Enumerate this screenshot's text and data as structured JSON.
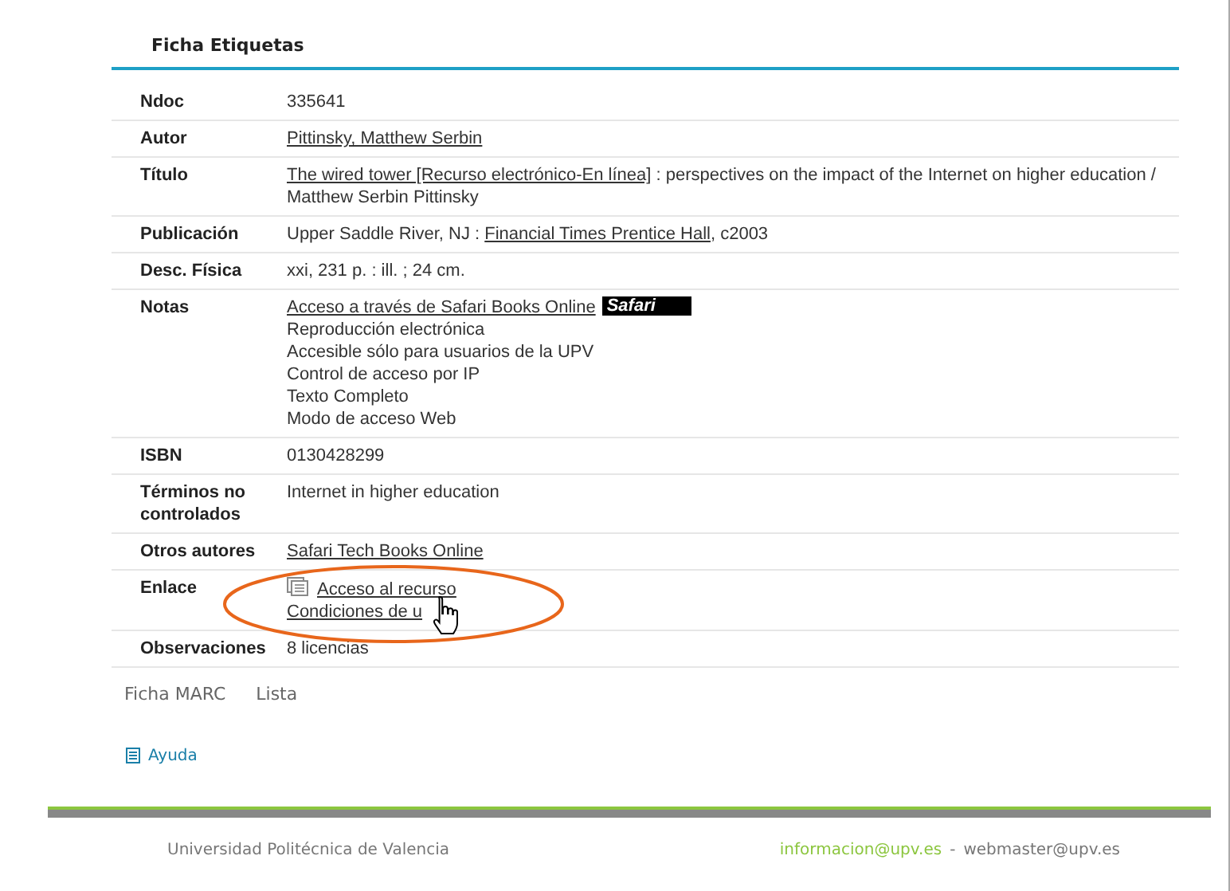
{
  "title": "Ficha Etiquetas",
  "rows": [
    {
      "label": "Ndoc",
      "lines": [
        [
          {
            "kind": "text",
            "text": "335641"
          }
        ]
      ]
    },
    {
      "label": "Autor",
      "lines": [
        [
          {
            "kind": "link",
            "text": "Pittinsky, Matthew Serbin"
          }
        ]
      ]
    },
    {
      "label": "Título",
      "lines": [
        [
          {
            "kind": "link",
            "text": "The wired tower [Recurso electrónico-En línea]"
          },
          {
            "kind": "text",
            "text": " : perspectives on the impact of the Internet on higher education / Matthew Serbin Pittinsky"
          }
        ]
      ]
    },
    {
      "label": "Publicación",
      "lines": [
        [
          {
            "kind": "text",
            "text": "Upper Saddle River, NJ : "
          },
          {
            "kind": "link",
            "text": "Financial Times Prentice Hall"
          },
          {
            "kind": "text",
            "text": ", c2003"
          }
        ]
      ]
    },
    {
      "label": "Desc. Física",
      "lines": [
        [
          {
            "kind": "text",
            "text": "xxi, 231 p. : ill. ; 24 cm."
          }
        ]
      ]
    },
    {
      "label": "Notas",
      "lines": [
        [
          {
            "kind": "link",
            "text": "Acceso a través de Safari Books Online"
          },
          {
            "kind": "logo",
            "text": "Safari"
          }
        ],
        [
          {
            "kind": "text",
            "text": "Reproducción electrónica"
          }
        ],
        [
          {
            "kind": "text",
            "text": "Accesible sólo para usuarios de la UPV"
          }
        ],
        [
          {
            "kind": "text",
            "text": "Control de acceso por IP"
          }
        ],
        [
          {
            "kind": "text",
            "text": "Texto Completo"
          }
        ],
        [
          {
            "kind": "text",
            "text": "Modo de acceso Web"
          }
        ]
      ]
    },
    {
      "label": "ISBN",
      "lines": [
        [
          {
            "kind": "text",
            "text": "0130428299"
          }
        ]
      ]
    },
    {
      "label": "Términos no controlados",
      "lines": [
        [
          {
            "kind": "text",
            "text": "Internet in higher education"
          }
        ]
      ]
    },
    {
      "label": "Otros autores",
      "lines": [
        [
          {
            "kind": "link",
            "text": "Safari Tech Books Online"
          }
        ]
      ]
    },
    {
      "label": "Enlace",
      "lines": [
        [
          {
            "kind": "icon"
          },
          {
            "kind": "link",
            "text": "Acceso al recurso"
          }
        ],
        [
          {
            "kind": "link",
            "text": "Condiciones de u"
          }
        ]
      ]
    },
    {
      "label": "Observaciones",
      "lines": [
        [
          {
            "kind": "text",
            "text": "8 licencias"
          }
        ]
      ]
    }
  ],
  "views": [
    "Ficha MARC",
    "Lista"
  ],
  "help": "Ayuda",
  "footer": {
    "university": "Universidad Politécnica de Valencia",
    "email_1": "informacion@upv.es",
    "separator": "-",
    "email_2": "webmaster@upv.es"
  }
}
